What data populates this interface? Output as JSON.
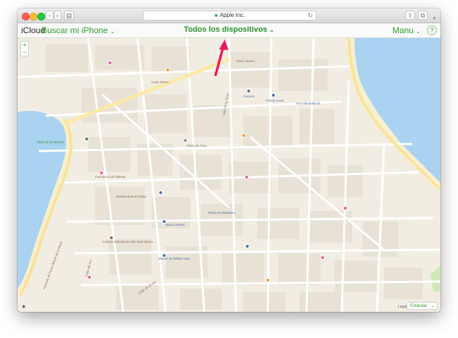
{
  "browser": {
    "url": "Apple Inc.",
    "back": "‹",
    "forward": "›",
    "sidebar": "▤",
    "share": "⇪",
    "tabs": "⧉",
    "reload": "↻",
    "new_tab": "+"
  },
  "app": {
    "brand": "iCloud",
    "service": "Buscar mi iPhone",
    "service_chevron": "⌄",
    "devices": "Todos los dispositivos",
    "devices_chevron": "⌄",
    "user": "Manu",
    "user_chevron": "⌄",
    "help": "?"
  },
  "map": {
    "zoom_in": "+",
    "zoom_out": "−",
    "legal": "Legal",
    "map_type": "Estándar",
    "map_type_chevron": "⌄",
    "labels": [
      "Plaza de la Merced",
      "Arco Neumáticos",
      "Correos",
      "Policía Local",
      "Oficio de Pino",
      "Farmacia Las Salinas",
      "Museo de Bellas Artes",
      "Banco Pastor",
      "Hotel Riazor",
      "Calle de la Torre",
      "Avenida de Pedro Barrié de la Maza",
      "Calle del Sol",
      "Praza do Matadoiro",
      "Calle de Orzán",
      "Colegio Salesianos San Juan Bosco",
      "Restaurante El Salao",
      "Abaco Nuevo"
    ]
  },
  "colors": {
    "land": "#f2ede3",
    "block": "#e8e2d6",
    "road": "#ffffff",
    "major_road": "#fbe9a8",
    "water": "#a9d3f0",
    "beach": "#f6efd0",
    "park": "#cfe8b8",
    "accent_green": "#2a9d2a",
    "arrow": "#e8185b"
  }
}
